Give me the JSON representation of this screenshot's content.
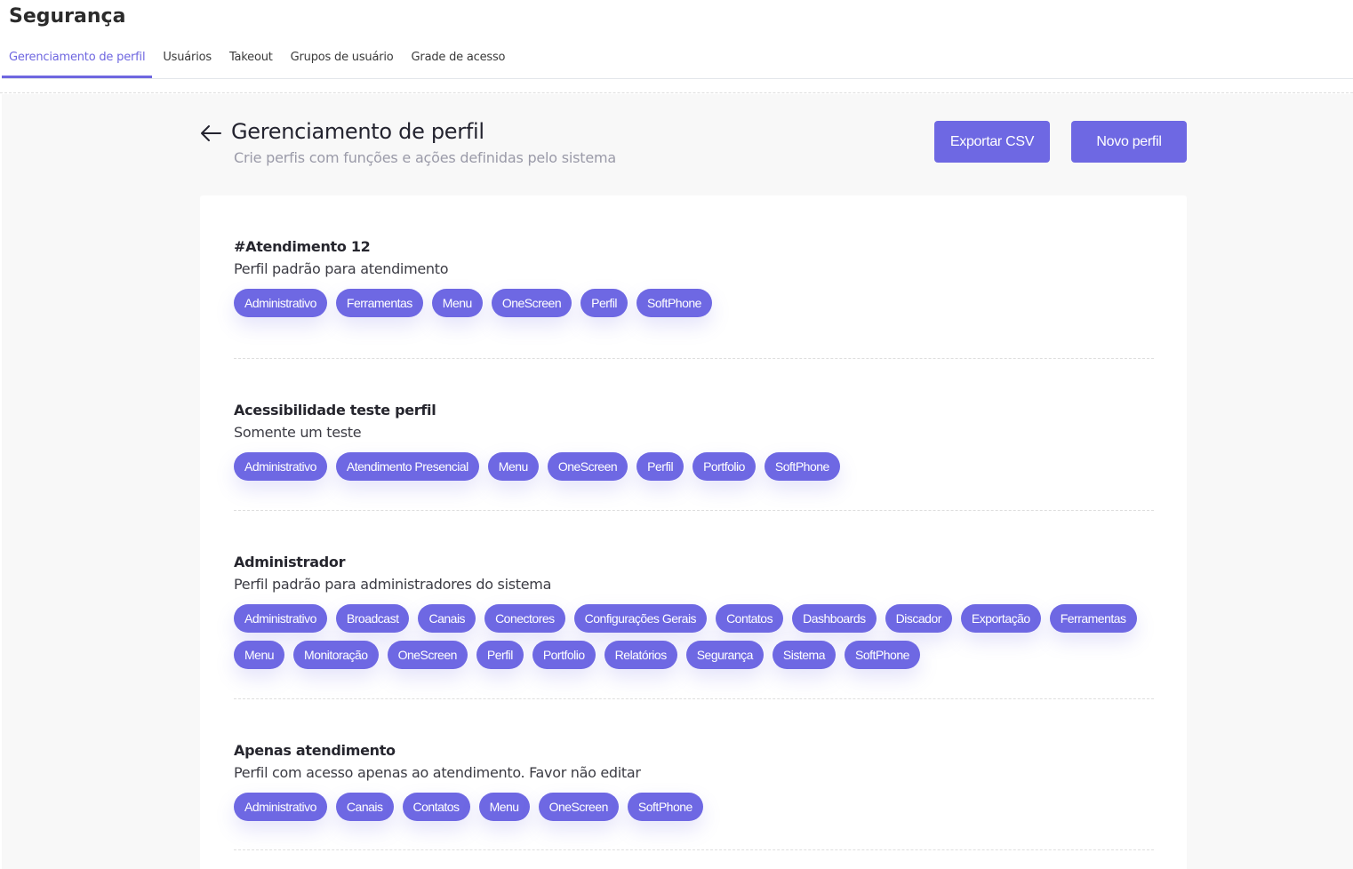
{
  "app": {
    "title": "Segurança"
  },
  "tabs": [
    {
      "label": "Gerenciamento de perfil",
      "active": true
    },
    {
      "label": "Usuários",
      "active": false
    },
    {
      "label": "Takeout",
      "active": false
    },
    {
      "label": "Grupos de usuário",
      "active": false
    },
    {
      "label": "Grade de acesso",
      "active": false
    }
  ],
  "header": {
    "back_icon": "arrow-left-icon",
    "title": "Gerenciamento de perfil",
    "subtitle": "Crie perfis com funções e ações definidas pelo sistema",
    "export_label": "Exportar CSV",
    "new_label": "Novo perfil"
  },
  "colors": {
    "accent": "#6e68e3",
    "tab_active": "#6e66e0"
  },
  "profiles": [
    {
      "name": "#Atendimento 12",
      "description": "Perfil padrão para atendimento",
      "modules": [
        "Administrativo",
        "Ferramentas",
        "Menu",
        "OneScreen",
        "Perfil",
        "SoftPhone"
      ]
    },
    {
      "name": "Acessibilidade teste perfil",
      "description": "Somente um teste",
      "modules": [
        "Administrativo",
        "Atendimento Presencial",
        "Menu",
        "OneScreen",
        "Perfil",
        "Portfolio",
        "SoftPhone"
      ]
    },
    {
      "name": "Administrador",
      "description": "Perfil padrão para administradores do sistema",
      "modules": [
        "Administrativo",
        "Broadcast",
        "Canais",
        "Conectores",
        "Configurações Gerais",
        "Contatos",
        "Dashboards",
        "Discador",
        "Exportação",
        "Ferramentas",
        "Menu",
        "Monitoração",
        "OneScreen",
        "Perfil",
        "Portfolio",
        "Relatórios",
        "Segurança",
        "Sistema",
        "SoftPhone"
      ]
    },
    {
      "name": "Apenas atendimento",
      "description": "Perfil com acesso apenas ao atendimento. Favor não editar",
      "modules": [
        "Administrativo",
        "Canais",
        "Contatos",
        "Menu",
        "OneScreen",
        "SoftPhone"
      ]
    }
  ]
}
